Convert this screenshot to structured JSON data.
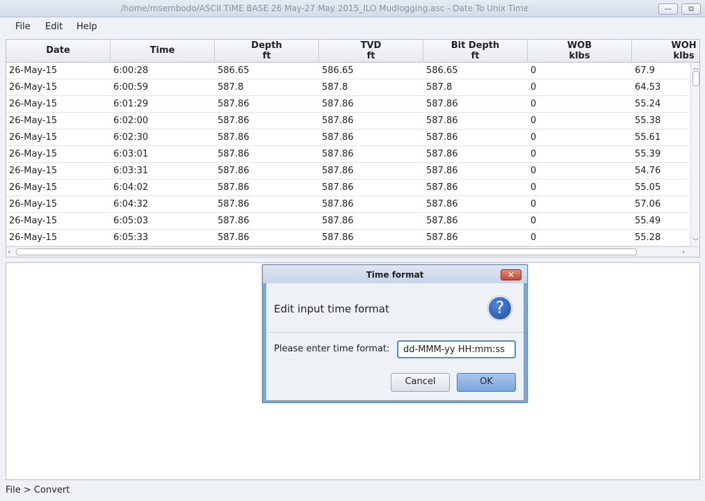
{
  "window": {
    "title": "/home/msembodo/ASCII TIME BASE 26 May-27 May 2015_ILO Mudlogging.asc - Date To Unix Time",
    "minimize_glyph": "—",
    "maximize_glyph": "⧉"
  },
  "menu": {
    "file": "File",
    "edit": "Edit",
    "help": "Help"
  },
  "table": {
    "columns": [
      {
        "name": "Date",
        "unit": ""
      },
      {
        "name": "Time",
        "unit": ""
      },
      {
        "name": "Depth",
        "unit": "ft"
      },
      {
        "name": "TVD",
        "unit": "ft"
      },
      {
        "name": "Bit Depth",
        "unit": "ft"
      },
      {
        "name": "WOB",
        "unit": "klbs"
      },
      {
        "name": "WOH",
        "unit": "klbs"
      }
    ],
    "rows": [
      [
        "26-May-15",
        "6:00:28",
        "586.65",
        "586.65",
        "586.65",
        "0",
        "67.9"
      ],
      [
        "26-May-15",
        "6:00:59",
        "587.8",
        "587.8",
        "587.8",
        "0",
        "64.53"
      ],
      [
        "26-May-15",
        "6:01:29",
        "587.86",
        "587.86",
        "587.86",
        "0",
        "55.24"
      ],
      [
        "26-May-15",
        "6:02:00",
        "587.86",
        "587.86",
        "587.86",
        "0",
        "55.38"
      ],
      [
        "26-May-15",
        "6:02:30",
        "587.86",
        "587.86",
        "587.86",
        "0",
        "55.61"
      ],
      [
        "26-May-15",
        "6:03:01",
        "587.86",
        "587.86",
        "587.86",
        "0",
        "55.39"
      ],
      [
        "26-May-15",
        "6:03:31",
        "587.86",
        "587.86",
        "587.86",
        "0",
        "54.76"
      ],
      [
        "26-May-15",
        "6:04:02",
        "587.86",
        "587.86",
        "587.86",
        "0",
        "55.05"
      ],
      [
        "26-May-15",
        "6:04:32",
        "587.86",
        "587.86",
        "587.86",
        "0",
        "57.06"
      ],
      [
        "26-May-15",
        "6:05:03",
        "587.86",
        "587.86",
        "587.86",
        "0",
        "55.49"
      ],
      [
        "26-May-15",
        "6:05:33",
        "587.86",
        "587.86",
        "587.86",
        "0",
        "55.28"
      ]
    ]
  },
  "statusbar": {
    "text": "File > Convert"
  },
  "dialog": {
    "title": "Time format",
    "close_glyph": "✕",
    "heading": "Edit input time format",
    "help_glyph": "?",
    "field_label": "Please enter time format:",
    "field_value": "dd-MMM-yy HH:mm:ss",
    "cancel_label": "Cancel",
    "ok_label": "OK"
  },
  "colors": {
    "dialog_border": "#7da5d6",
    "ok_button": "#7aa5dc",
    "close_button": "#c34a3a",
    "input_focus": "#4f8fd8"
  }
}
